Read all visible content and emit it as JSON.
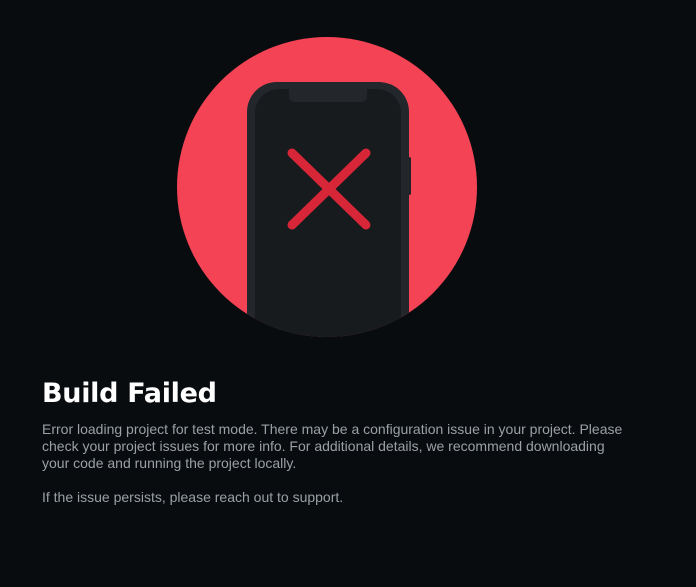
{
  "error": {
    "title": "Build Failed",
    "description": "Error loading project for test mode. There may be a configuration issue in your project. Please check your project issues for more info. For additional details, we recommend downloading your code and running the project locally.",
    "support_note": "If the issue persists, please reach out to support."
  },
  "illustration": {
    "name": "phone-error-icon",
    "circle_color": "#f44355",
    "phone_color": "#181b1e",
    "x_mark_color": "#d72637"
  },
  "theme": {
    "background": "#090c0f",
    "title_color": "#ffffff",
    "text_color": "#9aa0a6"
  }
}
